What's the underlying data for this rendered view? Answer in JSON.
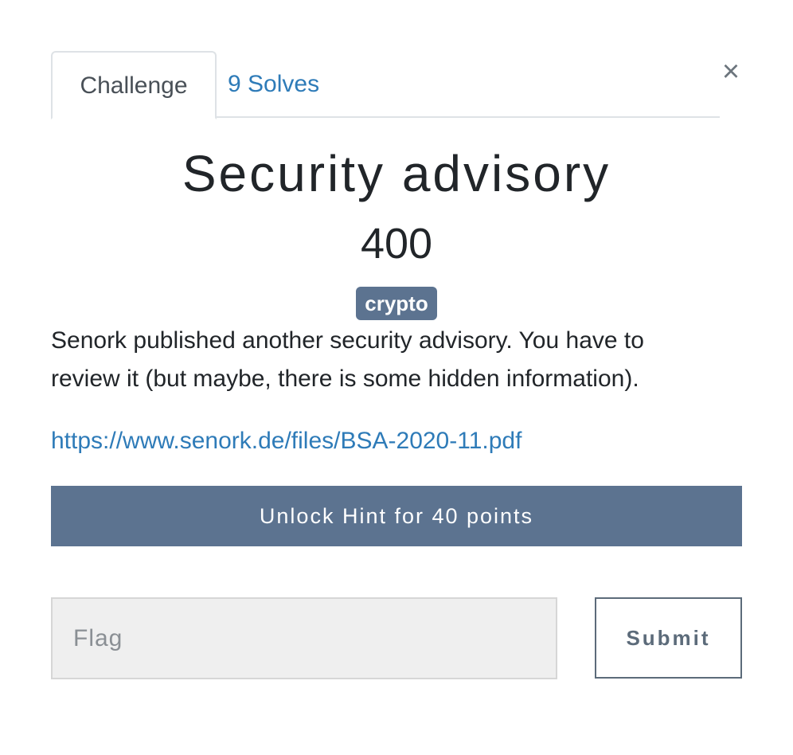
{
  "tabs": {
    "challenge": "Challenge",
    "solves": "9 Solves"
  },
  "close_glyph": "×",
  "challenge": {
    "title": "Security advisory",
    "points": "400",
    "category": "crypto",
    "description": "Senork published another security advisory. You have to review it (but maybe, there is some hidden information).",
    "file_link": "https://www.senork.de/files/BSA-2020-11.pdf"
  },
  "hint": {
    "button_label": "Unlock Hint for 40 points"
  },
  "form": {
    "flag_placeholder": "Flag",
    "flag_value": "",
    "submit_label": "Submit"
  },
  "colors": {
    "accent": "#5c7390",
    "link": "#2e7bb8"
  }
}
